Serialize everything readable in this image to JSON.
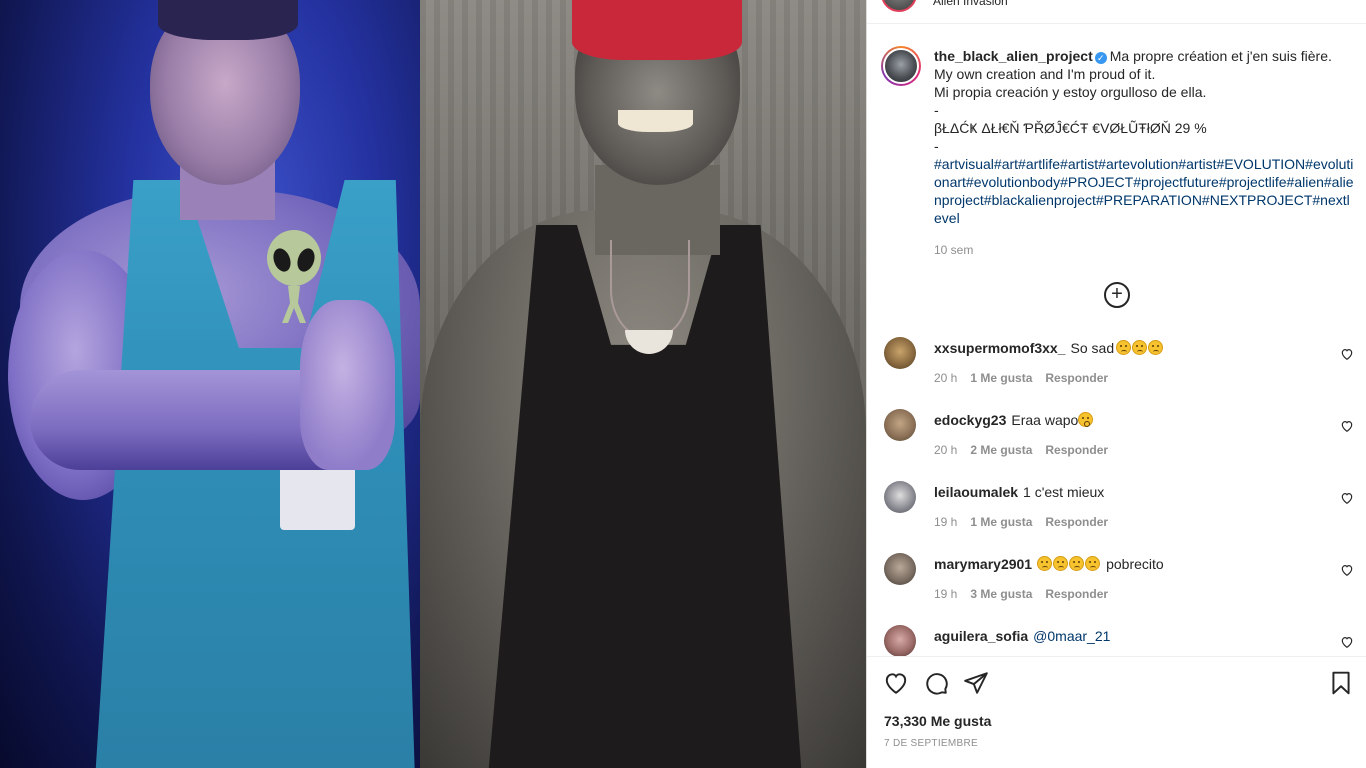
{
  "post": {
    "location": "Alien Invasion",
    "author": "the_black_alien_project",
    "caption_lines": [
      "Ma propre création et j'en suis fière.",
      "My own creation and I'm proud of it.",
      "Mi propia creación y estoy orgulloso de ella.",
      "-",
      "βŁΔĆҜ ΔŁł€Ň ƤŘØĴ€ĆŦ €VØŁŨŦłØŇ 29 %",
      "-"
    ],
    "hashtags": "#artvisual#art#artlife#artist#artevolution#artist#EVOLUTION#evolutionart#evolutionbody#PROJECT#projectfuture#projectlife#alien#alienproject#blackalienproject#PREPARATION#NEXTPROJECT#nextlevel",
    "time": "10 sem",
    "more_comments_symbol": "+"
  },
  "comments": [
    {
      "user": "xxsupermomof3xx_",
      "text": "So sad",
      "emojis": 3,
      "emoji_after": true,
      "time": "20 h",
      "likes": "1 Me gusta",
      "reply": "Responder"
    },
    {
      "user": "edockyg23",
      "text": "Eraa wapo",
      "emojis": 1,
      "emoji_after": true,
      "time": "20 h",
      "likes": "2 Me gusta",
      "reply": "Responder"
    },
    {
      "user": "leilaoumalek",
      "text": "1 c'est mieux",
      "emojis": 0,
      "time": "19 h",
      "likes": "1 Me gusta",
      "reply": "Responder"
    },
    {
      "user": "marymary2901",
      "text": "pobrecito",
      "emojis": 4,
      "emoji_after": false,
      "time": "19 h",
      "likes": "3 Me gusta",
      "reply": "Responder"
    },
    {
      "user": "aguilera_sofia",
      "text": "@0maar_21",
      "emojis": 0,
      "time": "",
      "likes": "",
      "reply": ""
    }
  ],
  "footer": {
    "likes": "73,330 Me gusta",
    "date": "7 de septiembre"
  },
  "icons": {
    "like": "heart-icon",
    "comment": "comment-bubble-icon",
    "share": "paper-plane-icon",
    "save": "bookmark-icon",
    "verified": "verified-badge-icon"
  }
}
